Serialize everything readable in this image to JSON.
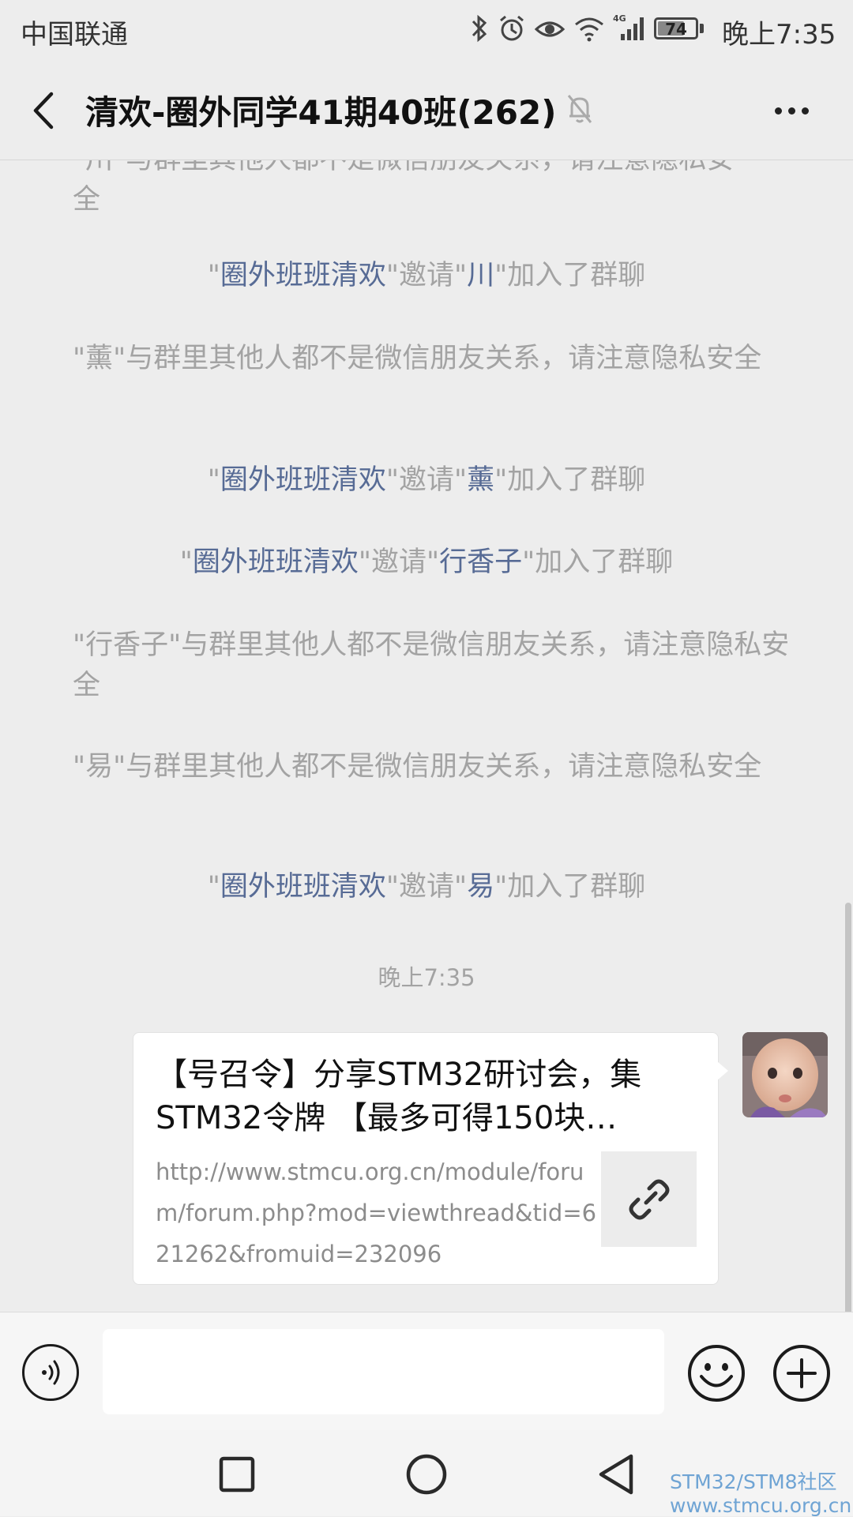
{
  "status_bar": {
    "carrier": "中国联通",
    "network": "4G",
    "battery": "74",
    "battery_level": 0.74,
    "time": "晚上7:35"
  },
  "header": {
    "title": "清欢-圈外同学41期40班(262)"
  },
  "messages": [
    {
      "type": "notice",
      "parts": [
        "\"川\"与群里其他人都不是微信朋友关系，请注意隐私安全"
      ]
    },
    {
      "type": "invite",
      "q1": "\"",
      "inviter": "圈外班班清欢",
      "mid": "\"邀请\"",
      "invitee": "川",
      "tail": "\"加入了群聊"
    },
    {
      "type": "notice",
      "text": "\"薰\"与群里其他人都不是微信朋友关系，请注意隐私安全"
    },
    {
      "type": "invite",
      "q1": "\"",
      "inviter": "圈外班班清欢",
      "mid": "\"邀请\"",
      "invitee": "薰",
      "tail": "\"加入了群聊"
    },
    {
      "type": "invite",
      "q1": "\"",
      "inviter": "圈外班班清欢",
      "mid": "\"邀请\"",
      "invitee": "行香子",
      "tail": "\"加入了群聊"
    },
    {
      "type": "notice",
      "text": "\"行香子\"与群里其他人都不是微信朋友关系，请注意隐私安全"
    },
    {
      "type": "notice",
      "text": "\"易\"与群里其他人都不是微信朋友关系，请注意隐私安全"
    },
    {
      "type": "invite",
      "q1": "\"",
      "inviter": "圈外班班清欢",
      "mid": "\"邀请\"",
      "invitee": "易",
      "tail": "\"加入了群聊"
    }
  ],
  "top_partial": {
    "line1": "\"川\"与群里其他人都不是微信朋友关系，请注意隐私安",
    "line2": "全"
  },
  "timestamp": "晚上7:35",
  "link_card": {
    "title": "【号召令】分享STM32研讨会，集STM32令牌 【最多可得150块…",
    "url": "http://www.stmcu.org.cn/module/forum/forum.php?mod=viewthread&tid=621262&fromuid=232096"
  },
  "input": {
    "value": "",
    "placeholder": ""
  },
  "watermark": {
    "line1": "STM32/STM8社区",
    "line2": "www.stmcu.org.cn"
  },
  "icons": {
    "back": "back-arrow-icon",
    "mute": "mute-bell-icon",
    "more": "more-dots-icon",
    "voice": "voice-icon",
    "emoji": "emoji-icon",
    "plus": "plus-icon",
    "link": "link-icon"
  },
  "colors": {
    "highlight": "#576b95",
    "system_text": "#a3a3a3",
    "background": "#ededed"
  }
}
